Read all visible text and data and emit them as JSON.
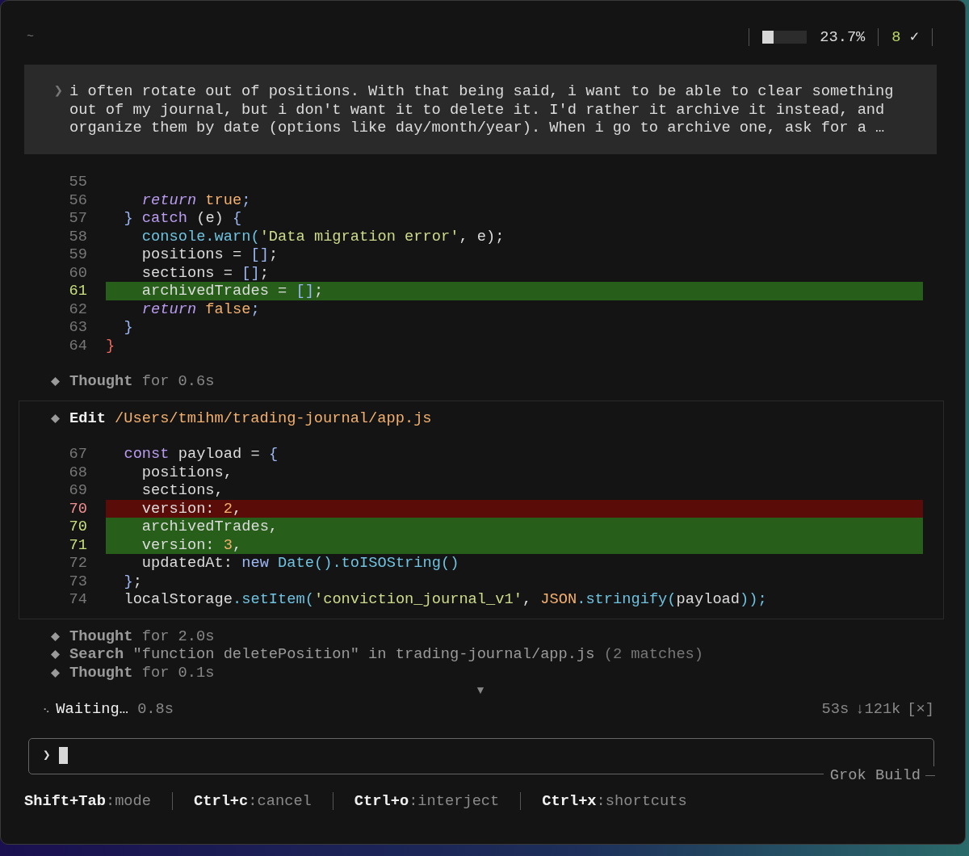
{
  "header": {
    "cwd": "~",
    "context_meter": {
      "level": 0.25
    },
    "context_percent": "23.7%",
    "count": "8",
    "check": "✓"
  },
  "prompt": {
    "chevron": "❯",
    "text": "i often rotate out of positions. With that being said, i want to be able to clear something out of my journal, but i don't want it to delete it. I'd rather it archive it instead, and organize them by date (options like day/month/year). When i go to archive one, ask for a …"
  },
  "code_block": {
    "lines": [
      {
        "number": "55",
        "kind": "context"
      },
      {
        "number": "56",
        "kind": "context",
        "tokens": [
          {
            "text": "    return",
            "kind": "keyword-italic"
          },
          {
            "text": " true",
            "kind": "literal"
          },
          {
            "text": ";",
            "kind": "punct"
          }
        ]
      },
      {
        "number": "57",
        "kind": "context",
        "tokens": [
          {
            "text": "  }",
            "kind": "punct"
          },
          {
            "text": " catch",
            "kind": "keyword"
          },
          {
            "text": " (e) ",
            "kind": "plain"
          },
          {
            "text": "{",
            "kind": "punct"
          }
        ]
      },
      {
        "number": "58",
        "kind": "context",
        "tokens": [
          {
            "text": "    console.warn(",
            "kind": "func"
          },
          {
            "text": "'Data migration error'",
            "kind": "string"
          },
          {
            "text": ", e);",
            "kind": "plain"
          }
        ]
      },
      {
        "number": "59",
        "kind": "context",
        "tokens": [
          {
            "text": "    positions = ",
            "kind": "plain"
          },
          {
            "text": "[]",
            "kind": "punct"
          },
          {
            "text": ";",
            "kind": "plain"
          }
        ]
      },
      {
        "number": "60",
        "kind": "context",
        "tokens": [
          {
            "text": "    sections = ",
            "kind": "plain"
          },
          {
            "text": "[]",
            "kind": "punct"
          },
          {
            "text": ";",
            "kind": "plain"
          }
        ]
      },
      {
        "number": "61",
        "kind": "added",
        "tokens": [
          {
            "text": "    archivedTrades = ",
            "kind": "plain"
          },
          {
            "text": "[]",
            "kind": "punct"
          },
          {
            "text": ";",
            "kind": "plain"
          }
        ]
      },
      {
        "number": "62",
        "kind": "context",
        "tokens": [
          {
            "text": "    return",
            "kind": "keyword-italic"
          },
          {
            "text": " false",
            "kind": "literal"
          },
          {
            "text": ";",
            "kind": "punct"
          }
        ]
      },
      {
        "number": "63",
        "kind": "context",
        "tokens": [
          {
            "text": "  }",
            "kind": "punct"
          }
        ]
      },
      {
        "number": "64",
        "kind": "context",
        "tokens": [
          {
            "text": "}",
            "kind": "brace-error"
          }
        ]
      }
    ]
  },
  "activity_before": [
    {
      "kind": "thought",
      "label": "Thought",
      "detail": "for 0.6s"
    }
  ],
  "edit": {
    "label": "Edit",
    "path": "/Users/tmihm/trading-journal/app.js",
    "lines": [
      {
        "number": "67",
        "kind": "context",
        "tokens": [
          {
            "text": "  const",
            "kind": "keyword"
          },
          {
            "text": " payload = ",
            "kind": "plain"
          },
          {
            "text": "{",
            "kind": "punct"
          }
        ]
      },
      {
        "number": "68",
        "kind": "context",
        "tokens": [
          {
            "text": "    positions,",
            "kind": "plain"
          }
        ]
      },
      {
        "number": "69",
        "kind": "context",
        "tokens": [
          {
            "text": "    sections,",
            "kind": "plain"
          }
        ]
      },
      {
        "number": "70",
        "kind": "removed",
        "tokens": [
          {
            "text": "    version: ",
            "kind": "plain"
          },
          {
            "text": "2",
            "kind": "literal"
          },
          {
            "text": ",",
            "kind": "plain"
          }
        ]
      },
      {
        "number": "70",
        "kind": "added",
        "tokens": [
          {
            "text": "    archivedTrades,",
            "kind": "plain"
          }
        ]
      },
      {
        "number": "71",
        "kind": "added",
        "tokens": [
          {
            "text": "    version: ",
            "kind": "plain"
          },
          {
            "text": "3",
            "kind": "literal"
          },
          {
            "text": ",",
            "kind": "plain"
          }
        ]
      },
      {
        "number": "72",
        "kind": "context",
        "tokens": [
          {
            "text": "    updatedAt: ",
            "kind": "plain"
          },
          {
            "text": "new",
            "kind": "keyword-blue"
          },
          {
            "text": " Date().toISOString()",
            "kind": "func"
          }
        ]
      },
      {
        "number": "73",
        "kind": "context",
        "tokens": [
          {
            "text": "  }",
            "kind": "punct"
          },
          {
            "text": ";",
            "kind": "plain"
          }
        ]
      },
      {
        "number": "74",
        "kind": "context",
        "tokens": [
          {
            "text": "  localStorage",
            "kind": "plain"
          },
          {
            "text": ".setItem(",
            "kind": "func"
          },
          {
            "text": "'conviction_journal_v1'",
            "kind": "string"
          },
          {
            "text": ", ",
            "kind": "plain"
          },
          {
            "text": "JSON",
            "kind": "literal"
          },
          {
            "text": ".stringify(",
            "kind": "func"
          },
          {
            "text": "payload",
            "kind": "plain"
          },
          {
            "text": "));",
            "kind": "func"
          }
        ]
      }
    ]
  },
  "activity_after": [
    {
      "kind": "thought",
      "label": "Thought",
      "detail": "for 2.0s"
    },
    {
      "kind": "search",
      "label": "Search",
      "detail": "\"function deletePosition\" in trading-journal/app.js",
      "note": "(2 matches)"
    },
    {
      "kind": "thought",
      "label": "Thought",
      "detail": "for 0.1s"
    }
  ],
  "more_indicator": "▼",
  "status": {
    "spinner": "⠢",
    "label": "Waiting…",
    "elapsed": "0.8s",
    "time": "53s",
    "tokens": "↓121k",
    "cancel": "[×]"
  },
  "input": {
    "chevron": "❯",
    "title": "Grok Build"
  },
  "shortcuts": [
    {
      "key": "Shift+Tab",
      "action": ":mode"
    },
    {
      "key": "Ctrl+c",
      "action": ":cancel"
    },
    {
      "key": "Ctrl+o",
      "action": ":interject"
    },
    {
      "key": "Ctrl+x",
      "action": ":shortcuts"
    }
  ]
}
